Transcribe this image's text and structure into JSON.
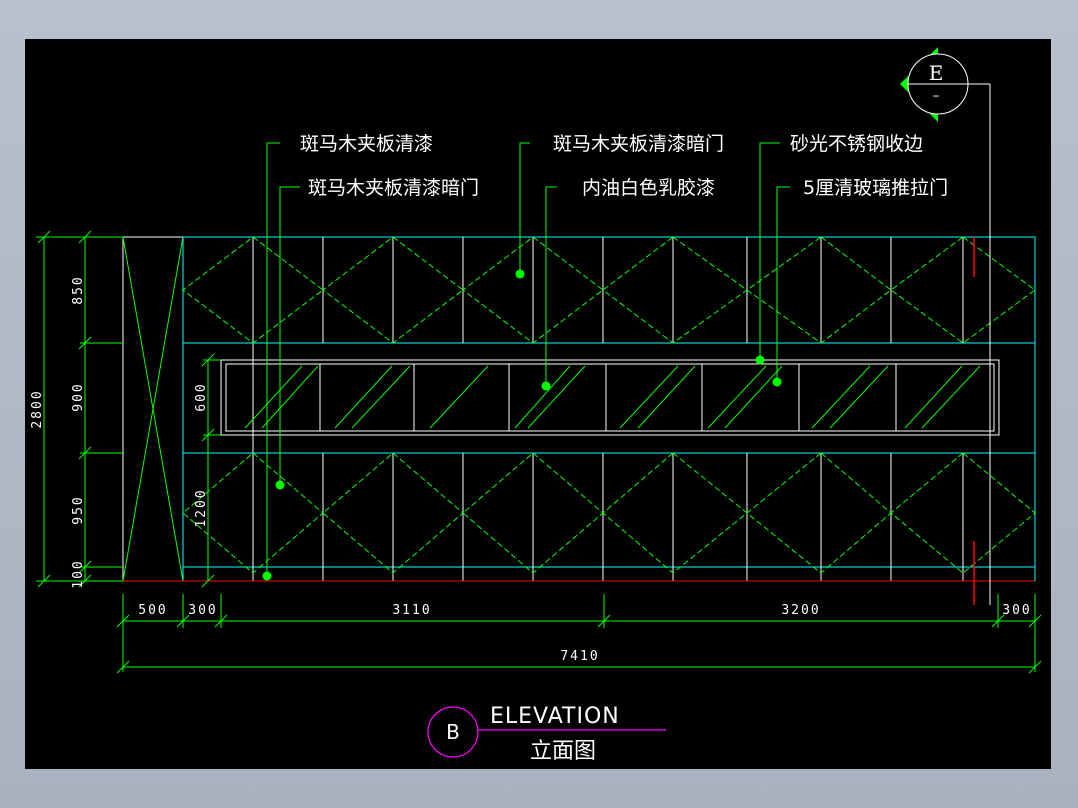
{
  "labels": {
    "l1": "斑马木夹板清漆",
    "l2": "斑马木夹板清漆暗门",
    "l3": "斑马木夹板清漆暗门",
    "l4": "内油白色乳胶漆",
    "l5": "砂光不锈钢收边",
    "l6": "5厘清玻璃推拉门"
  },
  "dims": {
    "h850": "850",
    "h900": "900",
    "h950": "950",
    "h100": "100",
    "h2800": "2800",
    "h600": "600",
    "h1200": "1200",
    "w500": "500",
    "w300a": "300",
    "w3110": "3110",
    "w3200": "3200",
    "w300b": "300",
    "w7410": "7410"
  },
  "title": {
    "marker": "B",
    "en": "ELEVATION",
    "cn": "立面图"
  },
  "section_marker": {
    "letter": "E",
    "dash": "–"
  },
  "colors": {
    "cyan": "#00ffff",
    "green": "#00ff00",
    "white": "#ffffff",
    "red": "#ff0000",
    "magenta": "#ff00ff",
    "leader_dot": "#00ff00"
  }
}
